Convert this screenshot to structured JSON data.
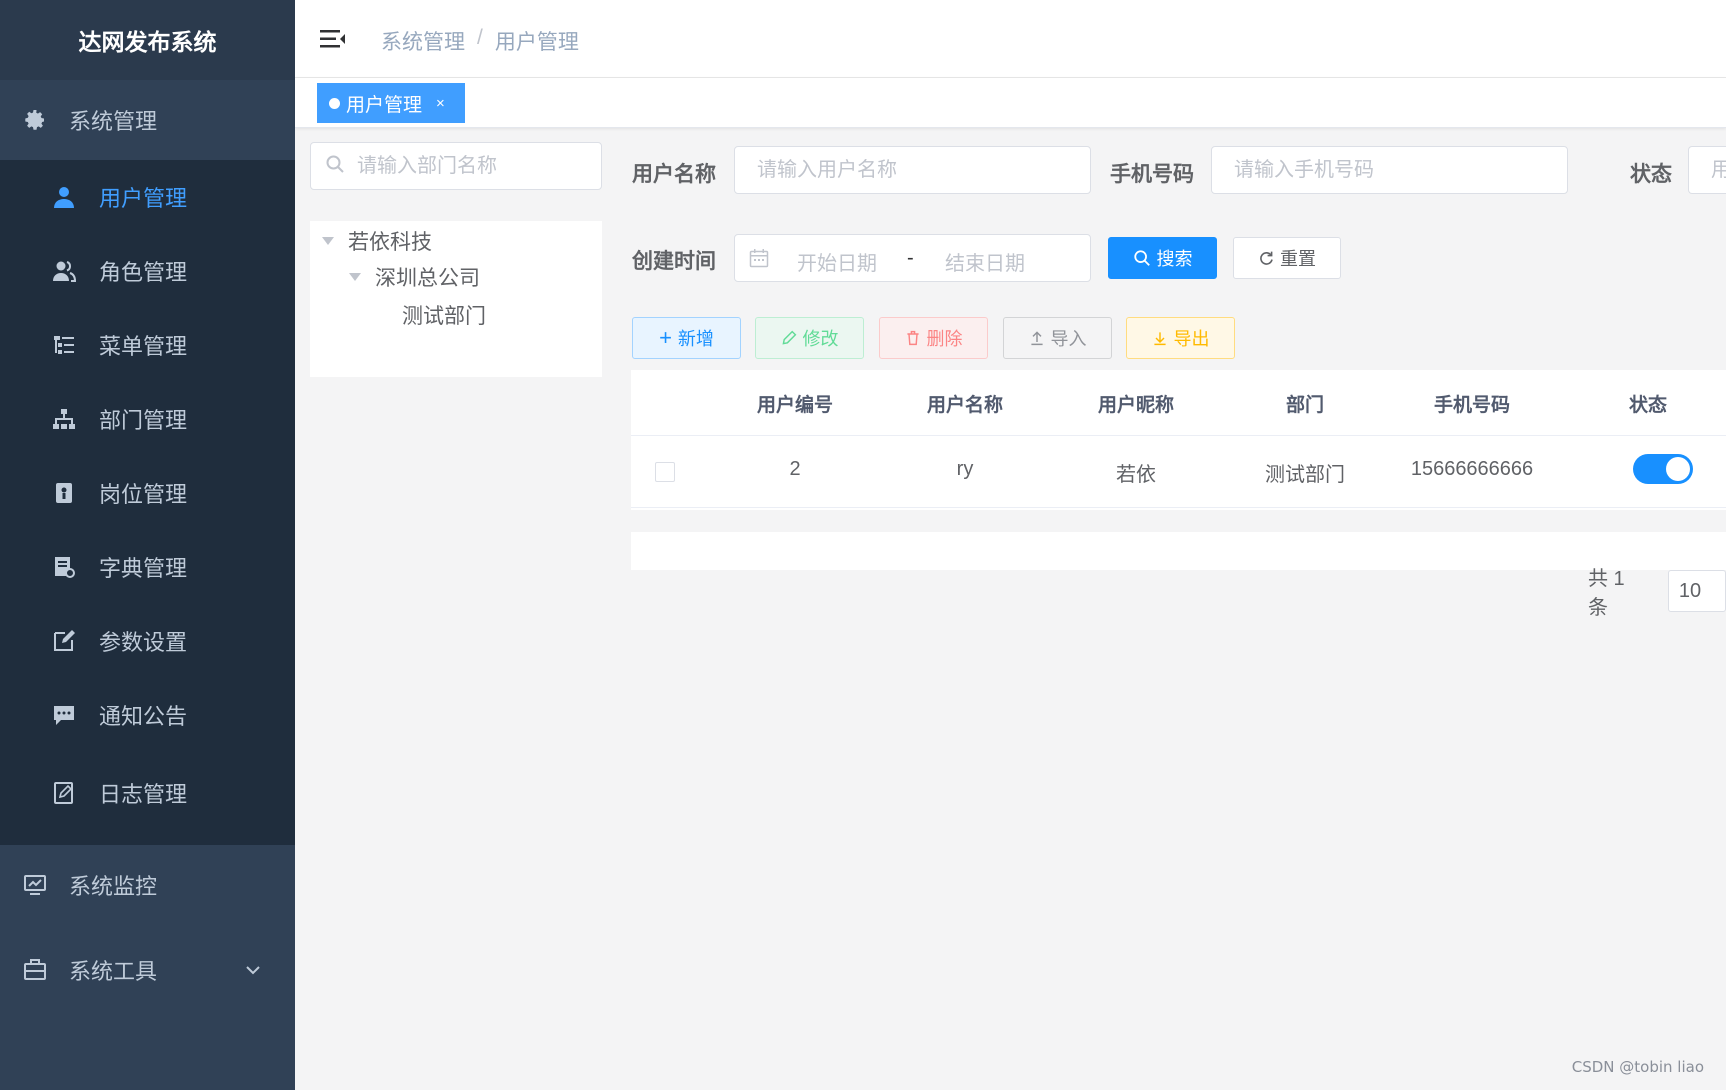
{
  "app": {
    "title": "达网发布系统"
  },
  "sidebar": {
    "groups": [
      {
        "label": "系统管理",
        "icon": "gear-icon",
        "expanded": true
      },
      {
        "label": "系统监控",
        "icon": "monitor-icon"
      },
      {
        "label": "系统工具",
        "icon": "toolbox-icon"
      }
    ],
    "items": [
      {
        "label": "用户管理",
        "icon": "user-icon",
        "active": true
      },
      {
        "label": "角色管理",
        "icon": "people-icon"
      },
      {
        "label": "菜单管理",
        "icon": "tree-table-icon"
      },
      {
        "label": "部门管理",
        "icon": "org-tree-icon"
      },
      {
        "label": "岗位管理",
        "icon": "post-icon"
      },
      {
        "label": "字典管理",
        "icon": "dict-icon"
      },
      {
        "label": "参数设置",
        "icon": "edit-icon"
      },
      {
        "label": "通知公告",
        "icon": "message-icon"
      },
      {
        "label": "日志管理",
        "icon": "log-icon"
      }
    ]
  },
  "navbar": {
    "breadcrumb": [
      "系统管理",
      "用户管理"
    ],
    "separator": "/"
  },
  "tags": [
    {
      "label": "用户管理",
      "close": "×"
    }
  ],
  "dept": {
    "search_placeholder": "请输入部门名称",
    "tree": [
      {
        "label": "若依科技"
      },
      {
        "label": "深圳总公司"
      },
      {
        "label": "测试部门"
      }
    ]
  },
  "search": {
    "username_label": "用户名称",
    "username_placeholder": "请输入用户名称",
    "phone_label": "手机号码",
    "phone_placeholder": "请输入手机号码",
    "status_label": "状态",
    "status_placeholder": "用",
    "created_label": "创建时间",
    "start_placeholder": "开始日期",
    "range_separator": "-",
    "end_placeholder": "结束日期",
    "search_button": "搜索",
    "reset_button": "重置"
  },
  "toolbar": {
    "add": "新增",
    "edit": "修改",
    "delete": "删除",
    "import": "导入",
    "export": "导出"
  },
  "table": {
    "columns": [
      "用户编号",
      "用户名称",
      "用户昵称",
      "部门",
      "手机号码",
      "状态"
    ],
    "rows": [
      {
        "id": "2",
        "username": "ry",
        "nickname": "若依",
        "dept": "测试部门",
        "phone": "15666666666",
        "status_enabled": true
      }
    ]
  },
  "pagination": {
    "total_text": "共 1 条",
    "page_size": "10"
  },
  "watermark": "CSDN @tobin liao",
  "colors": {
    "sidebar": "#304156",
    "submenu": "#1f2d3d",
    "primary": "#1890ff",
    "active_menu": "#409eff"
  }
}
